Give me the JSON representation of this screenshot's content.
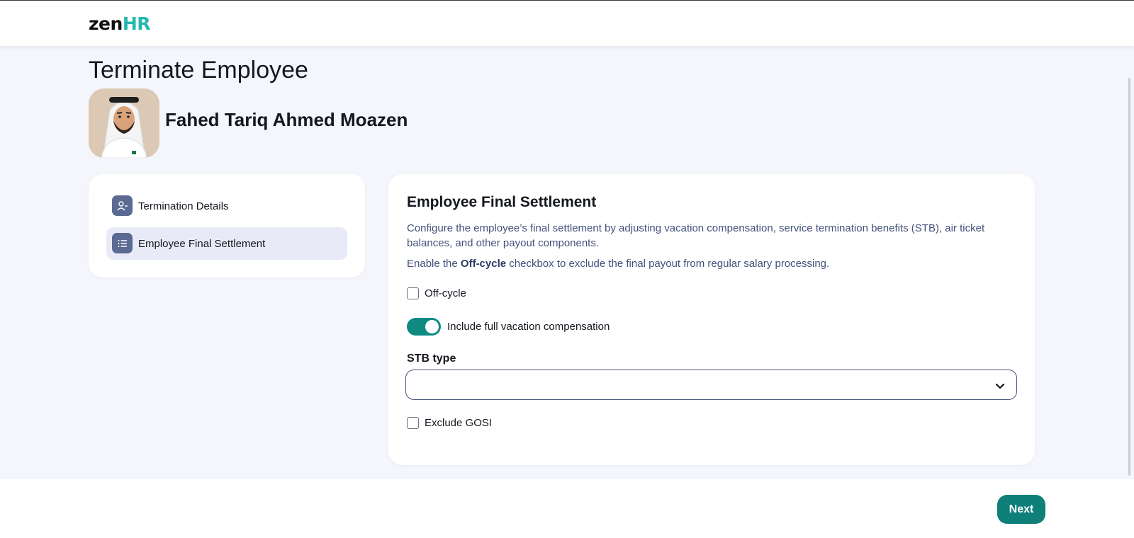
{
  "header": {
    "logo_zen": "zen",
    "logo_hr": "HR"
  },
  "page": {
    "title": "Terminate Employee"
  },
  "employee": {
    "name": "Fahed Tariq Ahmed Moazen"
  },
  "steps": [
    {
      "label": "Termination Details",
      "icon": "user-minus-icon",
      "active": false
    },
    {
      "label": "Employee Final Settlement",
      "icon": "list-icon",
      "active": true
    }
  ],
  "settlement": {
    "title": "Employee Final Settlement",
    "description": "Configure the employee’s final settlement by adjusting vacation compensation, service termination benefits (STB), air ticket balances, and other payout components.",
    "hint_prefix": "Enable the ",
    "hint_bold": "Off-cycle",
    "hint_suffix": " checkbox to exclude the final payout from regular salary processing.",
    "off_cycle_label": "Off-cycle",
    "off_cycle_checked": false,
    "vacation_toggle_label": "Include full vacation compensation",
    "vacation_toggle_on": true,
    "stb_label": "STB type",
    "stb_value": "",
    "exclude_gosi_label": "Exclude GOSI",
    "exclude_gosi_checked": false
  },
  "footer": {
    "next_label": "Next"
  },
  "colors": {
    "accent": "#0f8a83",
    "brand_hr": "#22b8b0",
    "step_icon_bg": "#5b6a92",
    "step_active_bg": "#e8ebf7"
  }
}
